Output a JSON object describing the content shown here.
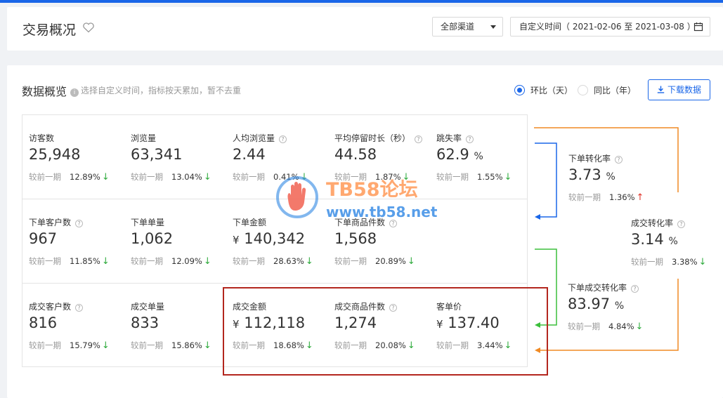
{
  "header": {
    "title": "交易概况",
    "channel_select": "全部渠道",
    "date_range": "自定义时间（ 2021-02-06 至 2021-03-08 ）"
  },
  "overview": {
    "title": "数据概览",
    "hint": "选择自定义时间，指标按天累加，暂不去重",
    "radio_day": "环比（天）",
    "radio_year": "同比（年）",
    "radio_selected": "环比（天）",
    "download": "下载数据",
    "compare_label": "较前一期"
  },
  "colors": {
    "primary": "#1a66e8",
    "down": "#2eaa3c",
    "up": "#e0352b",
    "orange": "#f08a24",
    "green": "#3bbf3b",
    "blue": "#1a66e8",
    "highlight": "#b3261e"
  },
  "metrics": {
    "r0": [
      {
        "label": "访客数",
        "value": "25,948",
        "pct": "12.89%",
        "dir": "down"
      },
      {
        "label": "浏览量",
        "value": "63,341",
        "pct": "13.04%",
        "dir": "down"
      },
      {
        "label": "人均浏览量",
        "value": "2.44",
        "pct": "0.41%",
        "dir": "down"
      },
      {
        "label": "平均停留时长（秒）",
        "value": "44.58",
        "pct": "1.87%",
        "dir": "down"
      },
      {
        "label": "跳失率",
        "value": "62.9",
        "unit": "%",
        "pct": "1.55%",
        "dir": "down"
      }
    ],
    "r1": [
      {
        "label": "下单客户数",
        "value": "967",
        "pct": "11.85%",
        "dir": "down"
      },
      {
        "label": "下单单量",
        "value": "1,062",
        "pct": "12.09%",
        "dir": "down"
      },
      {
        "label": "下单金额",
        "value": "140,342",
        "currency": "¥",
        "pct": "28.63%",
        "dir": "down"
      },
      {
        "label": "下单商品件数",
        "value": "1,568",
        "pct": "20.89%",
        "dir": "down"
      }
    ],
    "r2": [
      {
        "label": "成交客户数",
        "value": "816",
        "pct": "15.79%",
        "dir": "down"
      },
      {
        "label": "成交单量",
        "value": "833",
        "pct": "15.86%",
        "dir": "down"
      },
      {
        "label": "成交金额",
        "value": "112,118",
        "currency": "¥",
        "pct": "18.68%",
        "dir": "down"
      },
      {
        "label": "成交商品件数",
        "value": "1,274",
        "pct": "20.08%",
        "dir": "down"
      },
      {
        "label": "客单价",
        "value": "137.40",
        "currency": "¥",
        "pct": "3.44%",
        "dir": "down"
      }
    ]
  },
  "conversions": [
    {
      "label": "下单转化率",
      "value": "3.73",
      "unit": "%",
      "pct": "1.36%",
      "dir": "up"
    },
    {
      "label": "成交转化率",
      "value": "3.14",
      "unit": "%",
      "pct": "3.38%",
      "dir": "down"
    },
    {
      "label": "下单成交转化率",
      "value": "83.97",
      "unit": "%",
      "pct": "4.84%",
      "dir": "down"
    }
  ],
  "watermark": {
    "title": "TB58论坛",
    "url": "www.tb58.net"
  }
}
